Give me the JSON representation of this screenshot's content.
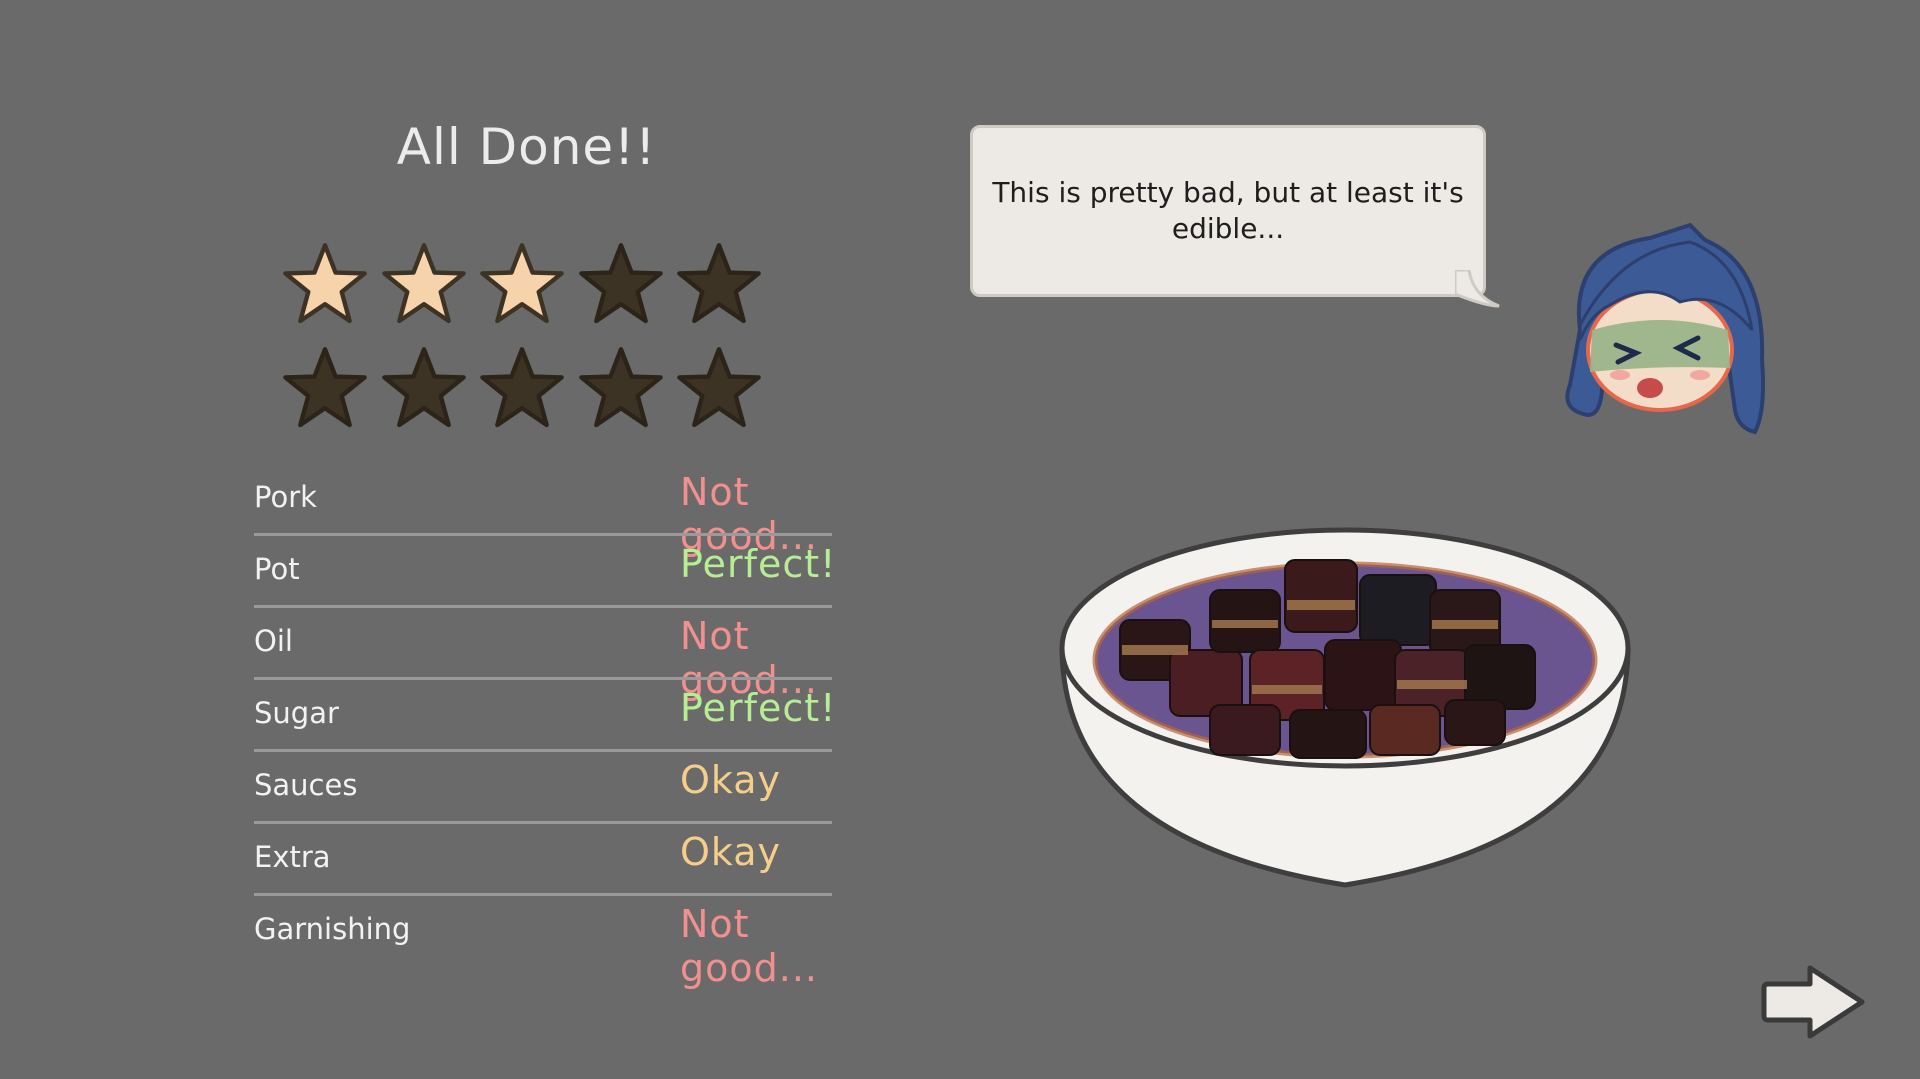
{
  "title": "All Done!!",
  "rating": {
    "filled": 3,
    "total": 10
  },
  "colors": {
    "background": "#6a6a6a",
    "star_filled": "#f7d3ab",
    "star_empty": "#3d3324",
    "not_good": "#f28f8f",
    "perfect": "#b6ee94",
    "okay": "#f5cf8a"
  },
  "results": [
    {
      "label": "Pork",
      "verdict": "Not good...",
      "grade": "not_good"
    },
    {
      "label": "Pot",
      "verdict": "Perfect!",
      "grade": "perfect"
    },
    {
      "label": "Oil",
      "verdict": "Not good...",
      "grade": "not_good"
    },
    {
      "label": "Sugar",
      "verdict": "Perfect!",
      "grade": "perfect"
    },
    {
      "label": "Sauces",
      "verdict": "Okay",
      "grade": "okay"
    },
    {
      "label": "Extra",
      "verdict": "Okay",
      "grade": "okay"
    },
    {
      "label": "Garnishing",
      "verdict": "Not good...",
      "grade": "not_good"
    }
  ],
  "speech": "This is pretty bad, but at least it's edible...",
  "icons": {
    "star": "star-icon",
    "character": "character-portrait",
    "dish": "braised-pork-bowl",
    "next": "right-arrow-icon"
  }
}
